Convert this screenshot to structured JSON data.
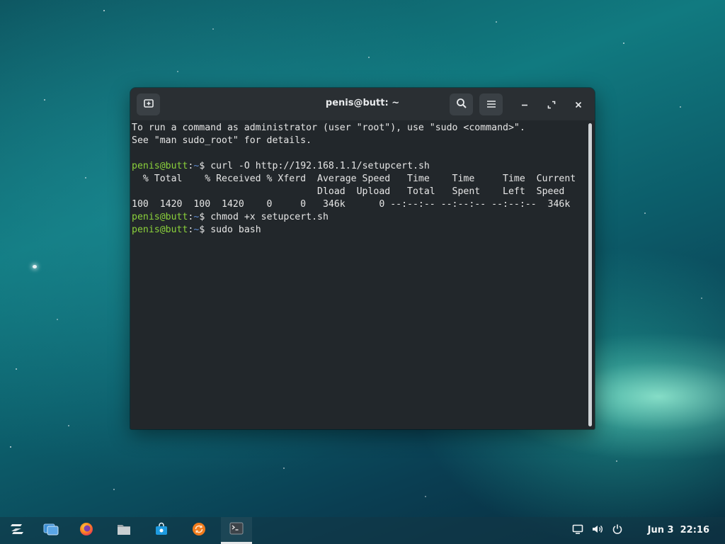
{
  "window": {
    "title": "penis@butt: ~"
  },
  "terminal": {
    "lines": [
      {
        "type": "text",
        "text": "To run a command as administrator (user \"root\"), use \"sudo <command>\"."
      },
      {
        "type": "text",
        "text": "See \"man sudo_root\" for details."
      },
      {
        "type": "text",
        "text": ""
      },
      {
        "type": "prompt",
        "user": "penis@butt",
        "sep": ":",
        "path": "~",
        "symbol": "$ ",
        "command": "curl -O http://192.168.1.1/setupcert.sh"
      },
      {
        "type": "text",
        "text": "  % Total    % Received % Xferd  Average Speed   Time    Time     Time  Current"
      },
      {
        "type": "text",
        "text": "                                 Dload  Upload   Total   Spent    Left  Speed"
      },
      {
        "type": "text",
        "text": "100  1420  100  1420    0     0   346k      0 --:--:-- --:--:-- --:--:--  346k"
      },
      {
        "type": "prompt",
        "user": "penis@butt",
        "sep": ":",
        "path": "~",
        "symbol": "$ ",
        "command": "chmod +x setupcert.sh"
      },
      {
        "type": "prompt",
        "user": "penis@butt",
        "sep": ":",
        "path": "~",
        "symbol": "$ ",
        "command": "sudo bash"
      }
    ]
  },
  "clock": {
    "text": "Jun 3  22:16"
  },
  "colors": {
    "prompt_user": "#8bd13b",
    "prompt_path": "#5f8cd2",
    "terminal_bg": "#22272b",
    "titlebar_bg": "#2a2f33"
  },
  "icons": {
    "new_tab": "new-tab-icon",
    "search": "search-icon",
    "menu": "hamburger-menu-icon",
    "minimize": "minimize-icon",
    "maximize": "maximize-icon",
    "close": "close-icon",
    "taskbar": [
      "zorin-menu-icon",
      "workspaces-icon",
      "firefox-icon",
      "files-icon",
      "software-store-icon",
      "software-updater-icon",
      "terminal-icon"
    ],
    "tray": [
      "screen-icon",
      "volume-icon",
      "power-icon"
    ]
  }
}
